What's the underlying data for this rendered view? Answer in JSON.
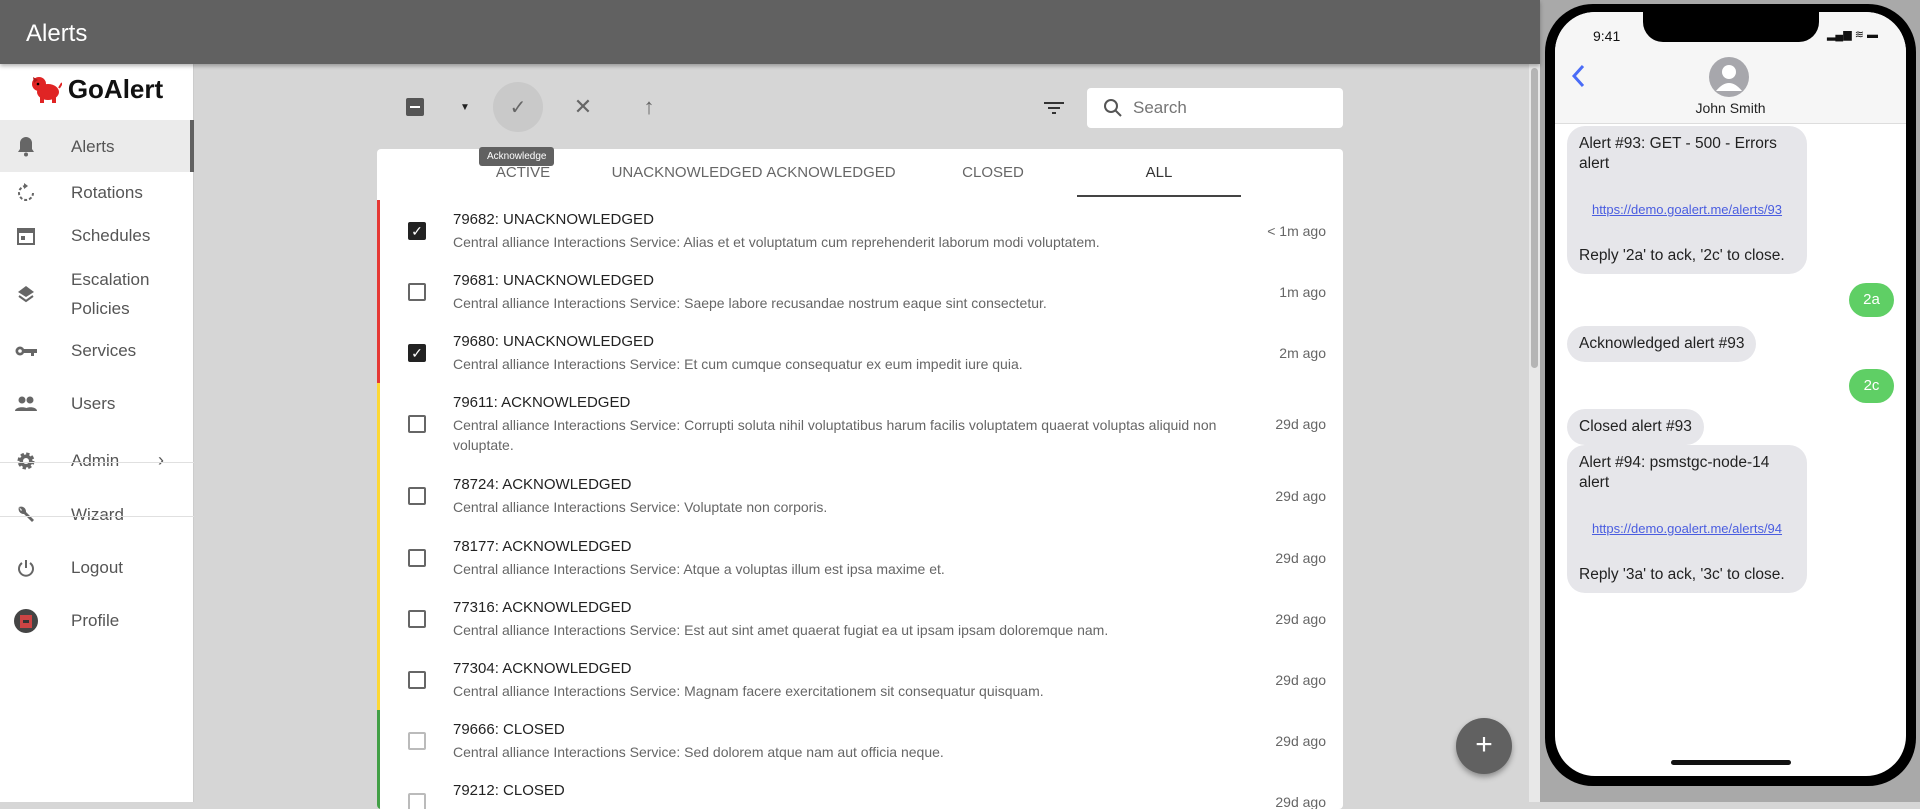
{
  "app": {
    "title": "Alerts",
    "logo_text": "GoAlert"
  },
  "sidebar": {
    "items": [
      {
        "label": "Alerts",
        "icon": "bell-icon"
      },
      {
        "label": "Rotations",
        "icon": "rotate-icon"
      },
      {
        "label": "Schedules",
        "icon": "calendar-icon"
      },
      {
        "label": "Escalation Policies",
        "icon": "layers-icon"
      },
      {
        "label": "Services",
        "icon": "key-icon"
      },
      {
        "label": "Users",
        "icon": "people-icon"
      },
      {
        "label": "Admin",
        "icon": "gear-icon"
      },
      {
        "label": "Wizard",
        "icon": "wrench-icon"
      },
      {
        "label": "Logout",
        "icon": "power-icon"
      },
      {
        "label": "Profile",
        "icon": "avatar-icon"
      }
    ]
  },
  "toolbar": {
    "tooltip": "Acknowledge",
    "search_placeholder": "Search"
  },
  "tabs": [
    {
      "label": "ACTIVE"
    },
    {
      "label": "UNACKNOWLEDGED"
    },
    {
      "label": "ACKNOWLEDGED"
    },
    {
      "label": "CLOSED"
    },
    {
      "label": "ALL",
      "selected": true
    }
  ],
  "alerts": [
    {
      "title": "79682: UNACKNOWLEDGED",
      "desc": "Central alliance Interactions Service: Alias et et voluptatum cum reprehenderit laborum modi voluptatem.",
      "time": "< 1m ago",
      "status": "unack",
      "checked": true
    },
    {
      "title": "79681: UNACKNOWLEDGED",
      "desc": "Central alliance Interactions Service: Saepe labore recusandae nostrum eaque sint consectetur.",
      "time": "1m ago",
      "status": "unack",
      "checked": false
    },
    {
      "title": "79680: UNACKNOWLEDGED",
      "desc": "Central alliance Interactions Service: Et cum cumque consequatur ex eum impedit iure quia.",
      "time": "2m ago",
      "status": "unack",
      "checked": true
    },
    {
      "title": "79611: ACKNOWLEDGED",
      "desc": "Central alliance Interactions Service: Corrupti soluta nihil voluptatibus harum facilis voluptatem quaerat voluptas aliquid non voluptate.",
      "time": "29d ago",
      "status": "ack",
      "checked": false
    },
    {
      "title": "78724: ACKNOWLEDGED",
      "desc": "Central alliance Interactions Service: Voluptate non corporis.",
      "time": "29d ago",
      "status": "ack",
      "checked": false
    },
    {
      "title": "78177: ACKNOWLEDGED",
      "desc": "Central alliance Interactions Service: Atque a voluptas illum est ipsa maxime et.",
      "time": "29d ago",
      "status": "ack",
      "checked": false
    },
    {
      "title": "77316: ACKNOWLEDGED",
      "desc": "Central alliance Interactions Service: Est aut sint amet quaerat fugiat ea ut ipsam ipsam doloremque nam.",
      "time": "29d ago",
      "status": "ack",
      "checked": false
    },
    {
      "title": "77304: ACKNOWLEDGED",
      "desc": "Central alliance Interactions Service: Magnam facere exercitationem sit consequatur quisquam.",
      "time": "29d ago",
      "status": "ack",
      "checked": false
    },
    {
      "title": "79666: CLOSED",
      "desc": "Central alliance Interactions Service: Sed dolorem atque nam aut officia neque.",
      "time": "29d ago",
      "status": "closed",
      "checked": false
    },
    {
      "title": "79212: CLOSED",
      "desc": "",
      "time": "29d ago",
      "status": "closed",
      "checked": false
    }
  ],
  "colors": {
    "unack": "#e53935",
    "ack": "#fdd835",
    "closed": "#43a047",
    "appbar": "#616161"
  },
  "phone": {
    "time": "9:41",
    "contact": "John Smith",
    "msg1": {
      "text": "Alert #93: GET - 500 - Errors alert",
      "link": "https://demo.goalert.me/alerts/93",
      "reply": "Reply '2a' to ack, '2c' to close."
    },
    "sent1": "2a",
    "recv2": "Acknowledged alert #93",
    "sent2": "2c",
    "recv3": "Closed alert #93",
    "msg4": {
      "text": "Alert #94: psmstgc-node-14 alert",
      "link": "https://demo.goalert.me/alerts/94",
      "reply": "Reply '3a' to ack, '3c' to close."
    }
  }
}
